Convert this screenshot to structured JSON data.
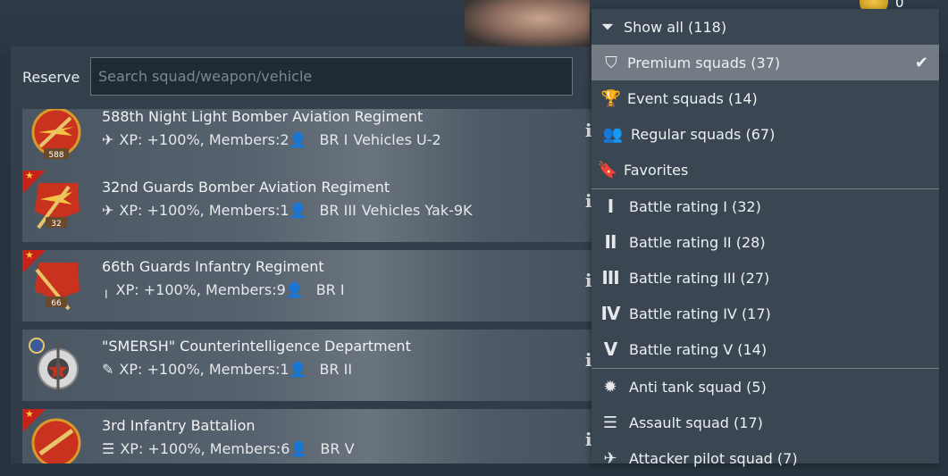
{
  "header": {
    "coin_count": "0"
  },
  "reserve": {
    "label": "Reserve",
    "search_placeholder": "Search squad/weapon/vehicle"
  },
  "squads": [
    {
      "title": "588th Night Light Bomber Aviation Regiment",
      "class_icon": "plane-icon",
      "xp": "XP: +100%, Members:2",
      "br": "BR I",
      "vehicles": "Vehicles U-2",
      "badge": "588",
      "premium": true
    },
    {
      "title": "32nd Guards Bomber Aviation Regiment",
      "class_icon": "plane-icon",
      "xp": "XP: +100%, Members:1",
      "br": "BR III",
      "vehicles": "Vehicles Yak-9K",
      "badge": "32",
      "premium": true
    },
    {
      "title": "66th Guards Infantry Regiment",
      "class_icon": "rifle-icon",
      "xp": "XP: +100%, Members:9",
      "br": "BR I",
      "vehicles": "",
      "badge": "66",
      "premium": true
    },
    {
      "title": "\"SMERSH\" Counterintelligence Department",
      "class_icon": "grenade-icon",
      "xp": "XP: +100%, Members:1",
      "br": "BR II",
      "vehicles": "",
      "badge": "",
      "premium": false
    },
    {
      "title": "3rd Infantry Battalion",
      "class_icon": "list-icon",
      "xp": "XP: +100%, Members:6",
      "br": "BR V",
      "vehicles": "",
      "badge": "",
      "premium": true
    }
  ],
  "info_label": "i",
  "filter_menu": {
    "items": [
      {
        "label": "Show all (118)",
        "icon": "filter-icon"
      },
      {
        "label": "Premium squads (37)",
        "icon": "shield-star-icon",
        "selected": true
      },
      {
        "label": "Event squads (14)",
        "icon": "trophy-icon"
      },
      {
        "label": "Regular squads (67)",
        "icon": "group-icon"
      },
      {
        "label": "Favorites",
        "icon": "bookmark-icon"
      },
      {
        "label": "Battle rating I (32)",
        "icon": "I"
      },
      {
        "label": "Battle rating II (28)",
        "icon": "II"
      },
      {
        "label": "Battle rating III (27)",
        "icon": "III"
      },
      {
        "label": "Battle rating IV (17)",
        "icon": "IV"
      },
      {
        "label": "Battle rating V (14)",
        "icon": "V"
      },
      {
        "label": "Anti tank squad (5)",
        "icon": "explosion-icon"
      },
      {
        "label": "Assault squad (17)",
        "icon": "list-icon"
      },
      {
        "label": "Attacker pilot squad (7)",
        "icon": "plane-icon"
      }
    ]
  },
  "colors": {
    "accent_red": "#c7221a",
    "gold": "#f5c542",
    "selected_bg": "#737c85"
  }
}
